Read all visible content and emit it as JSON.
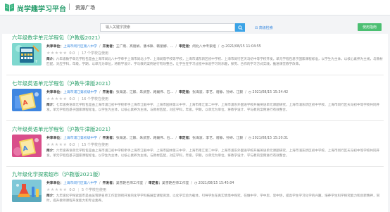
{
  "header": {
    "app_title": "尚学趣学习平台",
    "separator": "|",
    "breadcrumb": "资源广场"
  },
  "search": {
    "placeholder": "输入关键字搜索",
    "advanced_label": "高级检索",
    "help_label": "使用指南"
  },
  "labels": {
    "sharer": "共享单位：",
    "developer": "开发者：",
    "reviewer": "审定者：",
    "intro": "简介：",
    "rating_suffix": "个学校在使用"
  },
  "items": [
    {
      "title": "六年级数学单元学程包（沪教版2021）",
      "sharer": "上海市闵行区第八中学",
      "developer": "王广雨、高丽娟、潘书锋、韩丽娜、…",
      "reviewer": "闵北八中专家组",
      "date": "2021/08/15 11:04:55",
      "stars": "★★★★★",
      "score": "0.0",
      "usage": "17",
      "intro": "六年级数学单元学程包是由上海市闵北八中学牵手上海市闵北小学、上海闵鼎学校等学校，上海市浦东新区初中学校、上海市闵行区天马初中等学校开发。单元学程包基于国家课程标准，以学生为主体，以核心素养为主线，与教材匹配，对应学科，年级，学期，以单元为单位，将教学设计、学与教的案例进行有效整合，让学生在学习过程中体验学习的乐趣，探究、合作的学习方式实践，推进课堂教学改革。"
    },
    {
      "title": "七年级英语单元学程包（沪教牛津版2021）",
      "sharer": "上海市浦江第初级中学",
      "developer": "张海波、江毅、朱武营、路巍伟、石…",
      "reviewer": "张海波、李艺、诸静、孙婷、江毅",
      "date": "2021/08/15 15:34:42",
      "stars": "★★★★★",
      "score": "0.0",
      "usage": "16",
      "intro": "七年级英语单元学程包是由上海市浦江初中学校牵手上海市江毅中学、上海市园林第三中学、上海市南汇第二中学、上海市浦东外国语学校开展英语单元课题研究，上海市浦东新区初中学校、上海市闵行区天马初中等学校共同开发。单元学程包基于国家课程标准，以学生为主体，以核心素养为主线，与教材匹配，对应学科，年级，学期，以单元为单位，将教学设计、学与教的案例进行有效整合。"
    },
    {
      "title": "六年级英语单元学程包（沪教牛津版2021）",
      "sharer": "上海市浦江第初级中学",
      "developer": "张海波、江毅、朱武营、路巍伟、石…",
      "reviewer": "张海波、李艺、诸静、孙婷、江毅",
      "date": "2021/08/15 15:20:31",
      "stars": "★★★★★",
      "score": "0.0",
      "usage": "15",
      "intro": "六年级英语单元学程包是由上海市浦江初中学校牵手上海市江毅中学、上海市园林第三中学、上海市南汇第二中学、上海市浦东外国语学校开展英语单元课题研究，上海市浦东新区初中学校、上海市闵行区天马初中等学校共同开发。单元学程包基于国家课程标准，以学生为主体，以核心素养为主线，与教材匹配，对应学科，年级，学期，以单元为单位，将教学设计、学与教的案例进行有效整合。"
    },
    {
      "title": "九年级化学探索超市（沪教版2021版）",
      "sharer": "上海市闵行区第八中学",
      "developer": "吴雪艳名师工作室",
      "reviewer": "吴雪艳名师工作室",
      "date": "2021/08/15 15:45:04",
      "stars": "★★★★★",
      "score": "0.0",
      "usage": "5",
      "intro": "九年级化学探索超市是由吴雪艳名师工作室领衔开发的化学学科拓展型课程资源，以化学实验为载体，引导学生在真实情境中探究，在做中学、学中思、思中悟，提高学生学习化学的兴趣，培养学生科学探究能力和创新精神，同时，提升教师课程开发能力和专业素养。"
    }
  ],
  "colors": {
    "brand_green": "#2aa06a",
    "link_blue": "#3b8be0",
    "search_button": "#3ba3e6",
    "help_button": "#4cbf72"
  }
}
